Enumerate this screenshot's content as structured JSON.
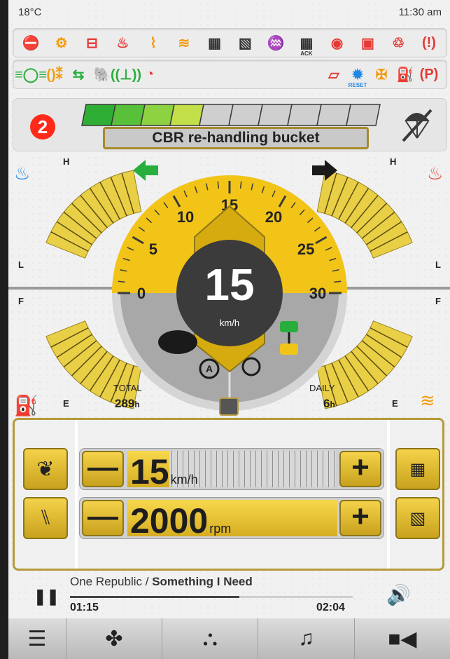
{
  "status": {
    "temperature": "18°C",
    "time": "11:30 am"
  },
  "warnings_row1": [
    {
      "icon": "engine-stop-icon",
      "glyph": "⛔",
      "color": "#e53935"
    },
    {
      "icon": "engine-check-icon",
      "glyph": "⚙",
      "color": "#f39c12"
    },
    {
      "icon": "battery-icon",
      "glyph": "⊟",
      "color": "#e53935"
    },
    {
      "icon": "oil-pressure-icon",
      "glyph": "♨",
      "color": "#e53935"
    },
    {
      "icon": "glow-plug-icon",
      "glyph": "⌇",
      "color": "#f39c12"
    },
    {
      "icon": "coolant-level-icon",
      "glyph": "≋",
      "color": "#f39c12"
    },
    {
      "icon": "dpf-icon",
      "glyph": "▦",
      "color": "#333333"
    },
    {
      "icon": "dpf-off-icon",
      "glyph": "▧",
      "color": "#333333"
    },
    {
      "icon": "exhaust-temp-icon",
      "glyph": "♒",
      "color": "#333333"
    },
    {
      "icon": "dpf-ack-icon",
      "glyph": "▦",
      "color": "#333333",
      "sub": "ACK"
    },
    {
      "icon": "hydraulic-oil-icon",
      "glyph": "◉",
      "color": "#e53935"
    },
    {
      "icon": "hydraulic-filter-icon",
      "glyph": "▣",
      "color": "#e53935"
    },
    {
      "icon": "transmission-icon",
      "glyph": "♲",
      "color": "#e53935"
    },
    {
      "icon": "brake-warning-icon",
      "glyph": "(!)",
      "color": "#e53935"
    }
  ],
  "warnings_row2_left": [
    {
      "icon": "side-lights-icon",
      "glyph": "≡◯≡",
      "color": "#27ae3c"
    },
    {
      "icon": "beacon-icon",
      "glyph": "()⁑",
      "color": "#f39c12"
    },
    {
      "icon": "indicators-icon",
      "glyph": "⇆",
      "color": "#27ae3c"
    },
    {
      "icon": "creep-mode-icon",
      "glyph": "🐘",
      "color": "#27ae3c"
    },
    {
      "icon": "radio-icon",
      "glyph": "((⊥))",
      "color": "#27ae3c"
    },
    {
      "icon": "overspeed-icon",
      "glyph": "◔",
      "color": "#e53935"
    }
  ],
  "warnings_row2_right": [
    {
      "icon": "door-open-icon",
      "glyph": "▱",
      "color": "#e53935"
    },
    {
      "icon": "service-reset-icon",
      "glyph": "✹",
      "color": "#1e88e5",
      "sub": "RESET"
    },
    {
      "icon": "hydraulic-temp-icon",
      "glyph": "✠",
      "color": "#f39c12"
    },
    {
      "icon": "fuel-low-icon",
      "glyph": "⛽",
      "color": "#f39c12"
    },
    {
      "icon": "park-brake-icon",
      "glyph": "(P)",
      "color": "#e53935"
    }
  ],
  "mode": {
    "gear": "2",
    "label": "CBR re-handling bucket",
    "segments_lit": 4,
    "segments_total": 10
  },
  "gauges": {
    "speed_value": "15",
    "speed_unit": "km/h",
    "dial_ticks": [
      "0",
      "5",
      "10",
      "15",
      "20",
      "25",
      "30"
    ],
    "dial_max": 30,
    "oil_temp": {
      "high": "H",
      "low": "L",
      "level": 0.55
    },
    "coolant_temp": {
      "high": "H",
      "low": "L",
      "level": 0.55
    },
    "fuel": {
      "full": "F",
      "empty": "E",
      "level": 0.6
    },
    "adblue": {
      "full": "F",
      "empty": "E",
      "level": 0.6
    },
    "total_label": "TOTAL",
    "total_value": "289",
    "total_unit": "h",
    "daily_label": "DAILY",
    "daily_value": "6",
    "daily_unit": "h"
  },
  "controls": {
    "speed_limit": {
      "value": "15",
      "unit": "km/h",
      "fraction": 0.2
    },
    "engine_rpm": {
      "value": "2000",
      "unit": "rpm",
      "fraction": 1.0
    },
    "minus": "—",
    "plus": "+"
  },
  "media": {
    "artist": "One Republic",
    "separator": " / ",
    "track": "Something I Need",
    "elapsed": "01:15",
    "duration": "02:04",
    "progress": 0.6
  },
  "colors": {
    "accent": "#f2c418",
    "warning": "#e53935",
    "ok": "#27ae3c"
  }
}
